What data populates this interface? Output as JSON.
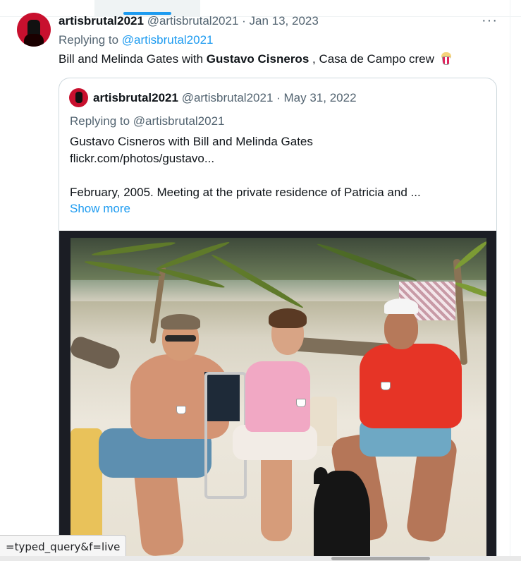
{
  "tweet": {
    "display_name": "artisbrutal2021",
    "meta": "@artisbrutal2021 · Jan 13, 2023",
    "more_label": "···",
    "replying_prefix": "Replying to ",
    "replying_handle": "@artisbrutal2021",
    "text_before": "Bill and Melinda Gates with ",
    "text_bold": "Gustavo Cisneros",
    "text_after": " , Casa de Campo crew",
    "emoji_icon": "popcorn-icon"
  },
  "quoted": {
    "display_name": "artisbrutal2021",
    "meta": "@artisbrutal2021 · May 31, 2022",
    "replying": "Replying to @artisbrutal2021",
    "line1": "Gustavo Cisneros with Bill and Melinda Gates",
    "line2": "flickr.com/photos/gustavo...",
    "line3": "February, 2005. Meeting at the private residence of Patricia and ...",
    "show_more": "Show more"
  },
  "status_bar": {
    "url_fragment": "=typed_query&f=live"
  },
  "colors": {
    "accent": "#1d9bf0",
    "text_primary": "#0f1419",
    "text_secondary": "#536471",
    "border": "#cfd9de"
  }
}
